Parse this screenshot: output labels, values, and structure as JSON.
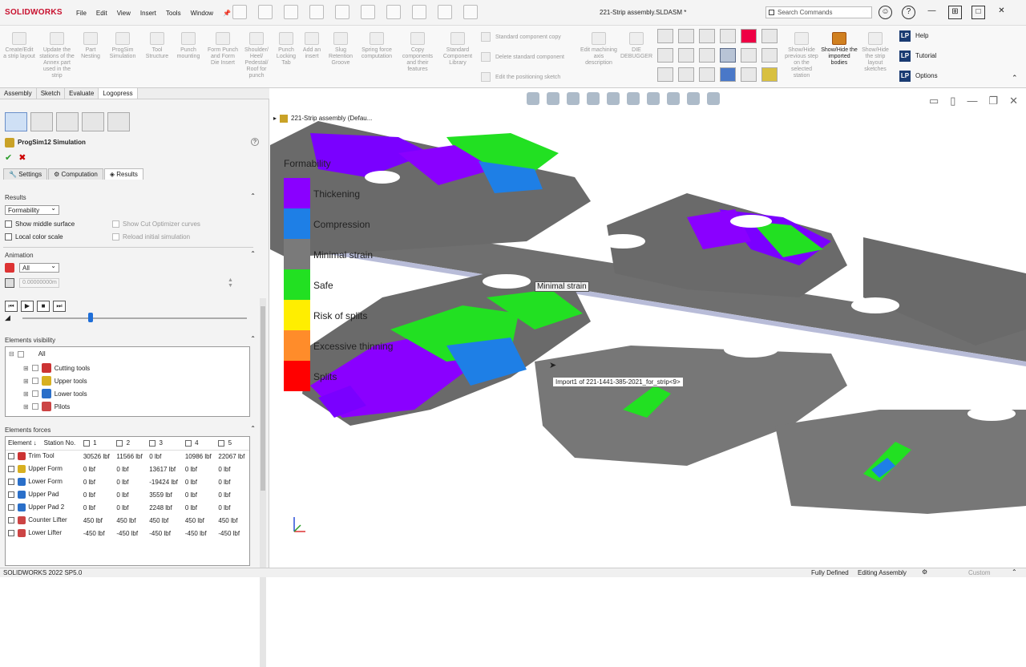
{
  "app": {
    "name": "SOLIDWORKS",
    "doc_title": "221-Strip assembly.SLDASM *",
    "search_placeholder": "Search Commands"
  },
  "menu": [
    "File",
    "Edit",
    "View",
    "Insert",
    "Tools",
    "Window"
  ],
  "ribbon": {
    "buttons": [
      "Create/Edit a strip layout",
      "Update the stations of the Annex part used in the strip",
      "Part Nesting",
      "ProgSim Simulation",
      "Tool Structure",
      "Punch mounting",
      "Form Punch and Form Die Insert",
      "Shoulder/ Heel/ Pedestal/ Roof for punch",
      "Punch Locking Tab",
      "Add an insert",
      "Slug Retention Groove",
      "Spring force computation",
      "Copy components and their features",
      "Standard Component Library",
      "Edit machining axis description",
      "DIE DEBUGGER",
      "Show/Hide previous step on the selected station",
      "Show/Hide the imported bodies",
      "Show/Hide the strip layout sketches"
    ],
    "rows": [
      "Standard component copy",
      "Delete standard component",
      "Edit the positioning sketch"
    ],
    "help": [
      "Help",
      "Tutorial",
      "Options"
    ]
  },
  "tabs": [
    "Assembly",
    "Sketch",
    "Evaluate",
    "Logopress"
  ],
  "panel": {
    "title": "ProgSim12 Simulation",
    "subtabs": [
      "Settings",
      "Computation",
      "Results"
    ],
    "results": {
      "header": "Results",
      "mode": "Formability",
      "show_middle": "Show middle surface",
      "local_color": "Local color scale",
      "show_cut": "Show Cut Optimizer curves",
      "reload": "Reload initial simulation"
    },
    "animation": {
      "header": "Animation",
      "select": "All",
      "value": "0.00000000m"
    },
    "visibility": {
      "header": "Elements visibility",
      "items": [
        "All",
        "Cutting tools",
        "Upper tools",
        "Lower tools",
        "Pilots"
      ]
    },
    "forces": {
      "header": "Elements forces",
      "columns": [
        "Element",
        "Station No.",
        "1",
        "2",
        "3",
        "4",
        "5"
      ],
      "rows": [
        {
          "name": "Trim Tool",
          "v": [
            "30526 lbf",
            "11566 lbf",
            "0 lbf",
            "10986 lbf",
            "22067 lbf"
          ]
        },
        {
          "name": "Upper Form",
          "v": [
            "0 lbf",
            "0 lbf",
            "13617 lbf",
            "0 lbf",
            "0 lbf"
          ]
        },
        {
          "name": "Lower Form",
          "v": [
            "0 lbf",
            "0 lbf",
            "-19424 lbf",
            "0 lbf",
            "0 lbf"
          ]
        },
        {
          "name": "Upper Pad",
          "v": [
            "0 lbf",
            "0 lbf",
            "3559 lbf",
            "0 lbf",
            "0 lbf"
          ]
        },
        {
          "name": "Upper Pad 2",
          "v": [
            "0 lbf",
            "0 lbf",
            "2248 lbf",
            "0 lbf",
            "0 lbf"
          ]
        },
        {
          "name": "Counter Lifter",
          "v": [
            "450 lbf",
            "450 lbf",
            "450 lbf",
            "450 lbf",
            "450 lbf"
          ]
        },
        {
          "name": "Lower Lifter",
          "v": [
            "-450 lbf",
            "-450 lbf",
            "-450 lbf",
            "-450 lbf",
            "-450 lbf"
          ]
        }
      ]
    }
  },
  "viewport": {
    "tree_item": "221-Strip assembly (Defau...",
    "legend": {
      "title": "Formability",
      "items": [
        {
          "label": "Thickening",
          "color": "#8a00ff"
        },
        {
          "label": "Compression",
          "color": "#1e7fe6"
        },
        {
          "label": "Minimal strain",
          "color": "#7a7a7a"
        },
        {
          "label": "Safe",
          "color": "#22e022"
        },
        {
          "label": "Risk of splits",
          "color": "#ffee00"
        },
        {
          "label": "Excessive thinning",
          "color": "#ff8c2a"
        },
        {
          "label": "Splits",
          "color": "#ff0000"
        }
      ]
    },
    "tooltip_strain": "Minimal strain",
    "tooltip_part": "Import1 of 221-1441-385-2021_for_strip<9>"
  },
  "status": {
    "version": "SOLIDWORKS 2022 SP5.0",
    "defined": "Fully Defined",
    "mode": "Editing Assembly",
    "custom": "Custom"
  }
}
